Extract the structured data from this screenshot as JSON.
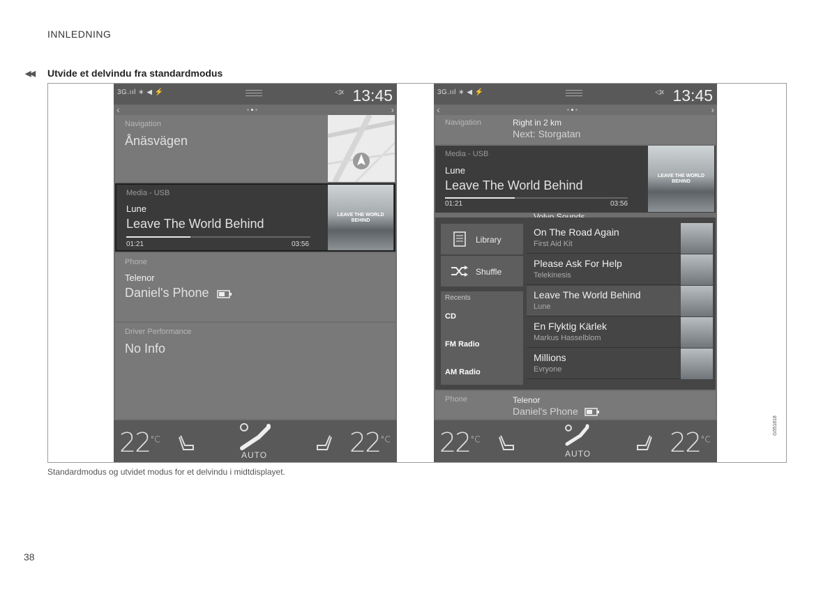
{
  "header": {
    "section": "INNLEDNING"
  },
  "title": {
    "back_glyph": "◀◀",
    "text": "Utvide et delvindu fra standardmodus"
  },
  "caption": "Standardmodus og utvidet modus for et delvindu i midtdisplayet.",
  "page_number": "38",
  "figure_ref": "G051818",
  "status": {
    "signal": "3G.ııl ∗ ◀ ⚡",
    "volume": "◁x",
    "time": "13:45"
  },
  "left_screen": {
    "navigation": {
      "label": "Navigation",
      "street": "Ånäsvägen"
    },
    "media": {
      "label": "Media - USB",
      "artist": "Lune",
      "track": "Leave The World Behind",
      "elapsed": "01:21",
      "duration": "03:56",
      "progress": 0.35,
      "art_text": "LEAVE THE WORLD BEHIND"
    },
    "phone": {
      "label": "Phone",
      "carrier": "Telenor",
      "device": "Daniel's Phone"
    },
    "driver": {
      "label": "Driver Performance",
      "value": "No Info"
    }
  },
  "right_screen": {
    "navigation": {
      "label": "Navigation",
      "instruction": "Right in 2 km",
      "next": "Next: Storgatan"
    },
    "media": {
      "label": "Media - USB",
      "artist": "Lune",
      "track": "Leave The World Behind",
      "elapsed": "01:21",
      "duration": "03:56",
      "progress": 0.38,
      "art_text": "LEAVE THE WORLD BEHIND"
    },
    "list_title": "Volvo Sounds",
    "buttons": {
      "library": "Library",
      "shuffle": "Shuffle"
    },
    "recents": {
      "heading": "Recents",
      "items": [
        "CD",
        "FM Radio",
        "AM Radio"
      ]
    },
    "songs": [
      {
        "title": "On The Road Again",
        "artist": "First Aid Kit"
      },
      {
        "title": "Please Ask For Help",
        "artist": "Telekinesis"
      },
      {
        "title": "Leave The World Behind",
        "artist": "Lune"
      },
      {
        "title": "En Flyktig Kärlek",
        "artist": "Markus Hasselblom"
      },
      {
        "title": "Millions",
        "artist": "Evryone"
      }
    ],
    "phone": {
      "label": "Phone",
      "carrier": "Telenor",
      "device": "Daniel's Phone"
    }
  },
  "climate": {
    "temp_left": "22",
    "temp_right": "22",
    "unit": "°C",
    "mode": "AUTO"
  },
  "colors": {
    "screen_bg": "#6e6e6e",
    "media_bg": "#3a3a3a",
    "bar_bg": "#595959"
  }
}
